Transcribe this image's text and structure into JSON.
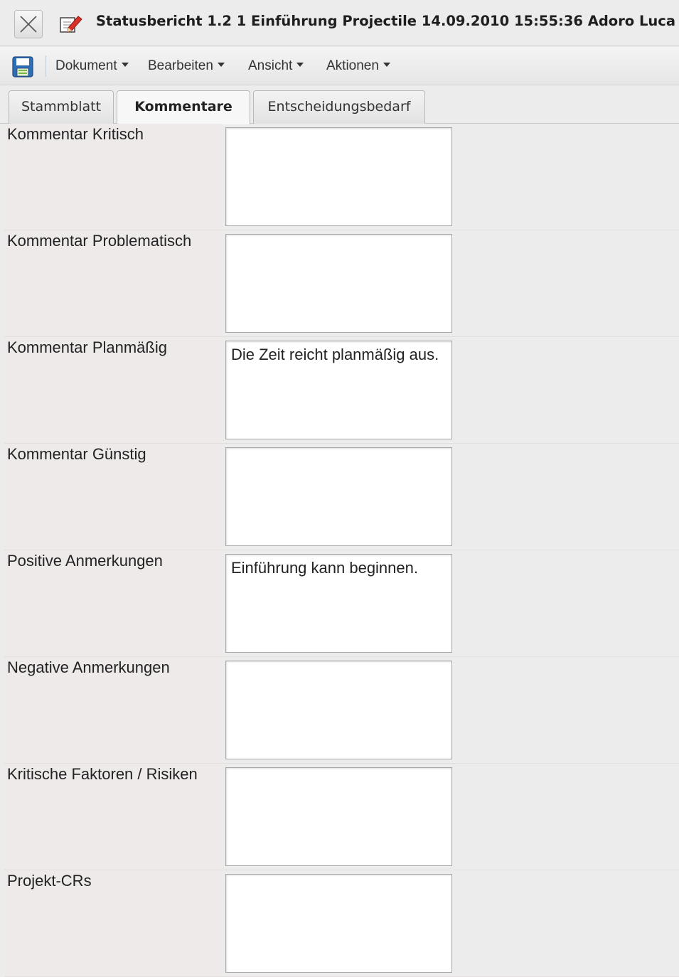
{
  "window": {
    "title": "Statusbericht 1.2 1 Einführung Projectile 14.09.2010 15:55:36 Adoro Luca",
    "icons": [
      "close-icon",
      "document-edit-icon"
    ]
  },
  "menubar": {
    "save_icon": "floppy-disk-icon",
    "items": [
      {
        "label": "Dokument"
      },
      {
        "label": "Bearbeiten"
      },
      {
        "label": "Ansicht"
      },
      {
        "label": "Aktionen"
      }
    ]
  },
  "tabs": [
    {
      "label": "Stammblatt",
      "active": false
    },
    {
      "label": "Kommentare",
      "active": true
    },
    {
      "label": "Entscheidungsbedarf",
      "active": false
    }
  ],
  "form": {
    "fields": [
      {
        "label": "Kommentar Kritisch",
        "value": ""
      },
      {
        "label": "Kommentar Problematisch",
        "value": ""
      },
      {
        "label": "Kommentar Planmäßig",
        "value": "Die Zeit reicht planmäßig aus."
      },
      {
        "label": "Kommentar Günstig",
        "value": ""
      },
      {
        "label": "Positive Anmerkungen",
        "value": "Einführung kann beginnen."
      },
      {
        "label": "Negative Anmerkungen",
        "value": ""
      },
      {
        "label": "Kritische Faktoren / Risiken",
        "value": ""
      },
      {
        "label": "Projekt-CRs",
        "value": ""
      }
    ]
  },
  "colors": {
    "background": "#ececec",
    "label_background": "#eeeaea",
    "field_background": "#ffffff",
    "save_icon_blue": "#2f6db5",
    "edit_icon_red": "#d9302a"
  }
}
